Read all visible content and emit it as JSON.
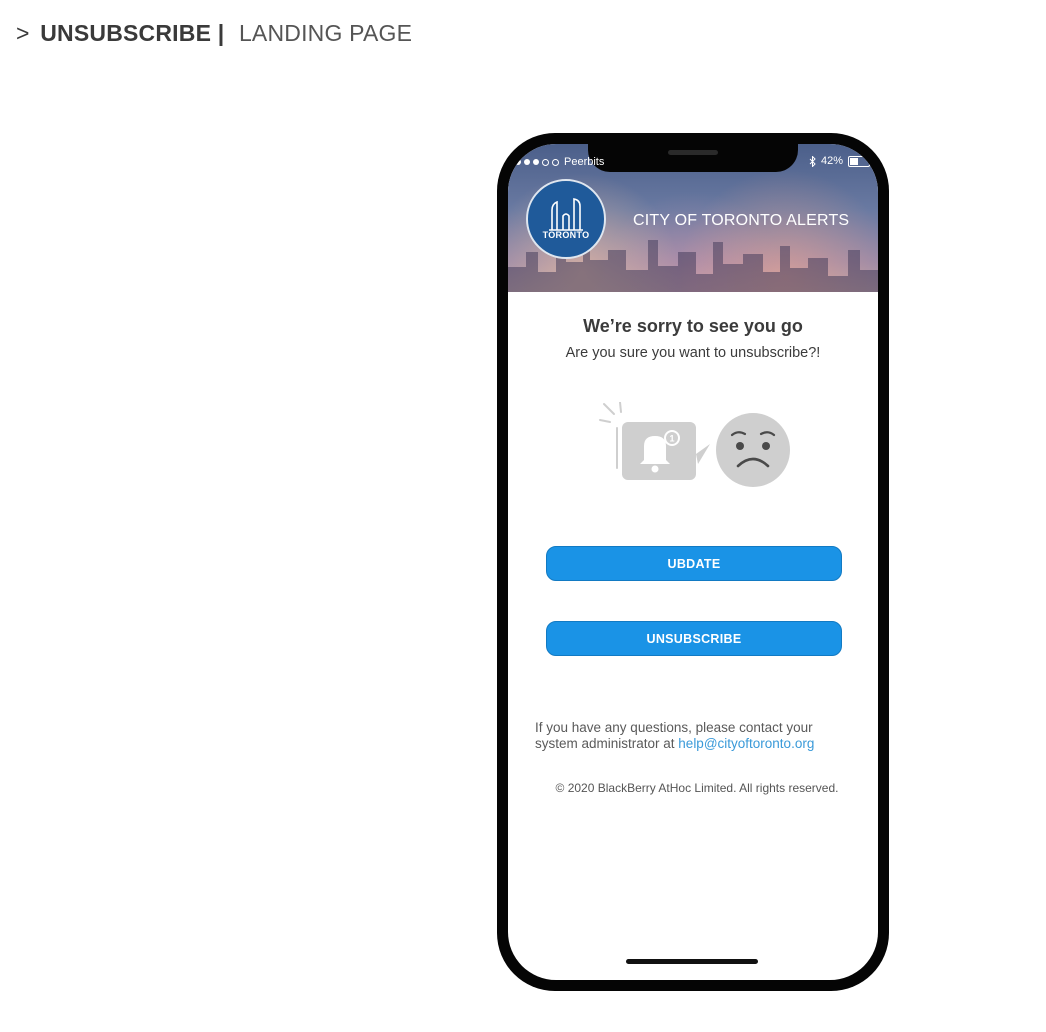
{
  "page_heading": {
    "arrow": ">",
    "section": "UNSUBSCRIBE |",
    "subsection": "LANDING PAGE"
  },
  "status_bar": {
    "carrier": "Peerbits",
    "battery": "42%",
    "battery_level": 0.42
  },
  "header": {
    "logo_text": "TORONTO",
    "title": "CITY OF TORONTO ALERTS"
  },
  "main": {
    "heading": "We’re sorry to see you go",
    "subheading": "Are you sure you want to unsubscribe?!",
    "notification_badge": "1",
    "update_button": "UBDATE",
    "unsubscribe_button": "UNSUBSCRIBE"
  },
  "footer": {
    "contact_text": "If you have any questions, please contact your system administrator at ",
    "contact_email": "help@cityoftoronto.org",
    "copyright": "© 2020 BlackBerry AtHoc Limited. All rights reserved."
  },
  "icons": {
    "logo": "toronto-city-hall-logo",
    "bell": "bell-icon",
    "sad_face": "sad-face-icon",
    "bluetooth": "bluetooth-icon",
    "battery": "battery-icon"
  },
  "colors": {
    "button_blue": "#1a93e6",
    "logo_blue": "#1f5a9a",
    "link_blue": "#3a9ad9",
    "illustration_gray": "#cfcfcf"
  }
}
